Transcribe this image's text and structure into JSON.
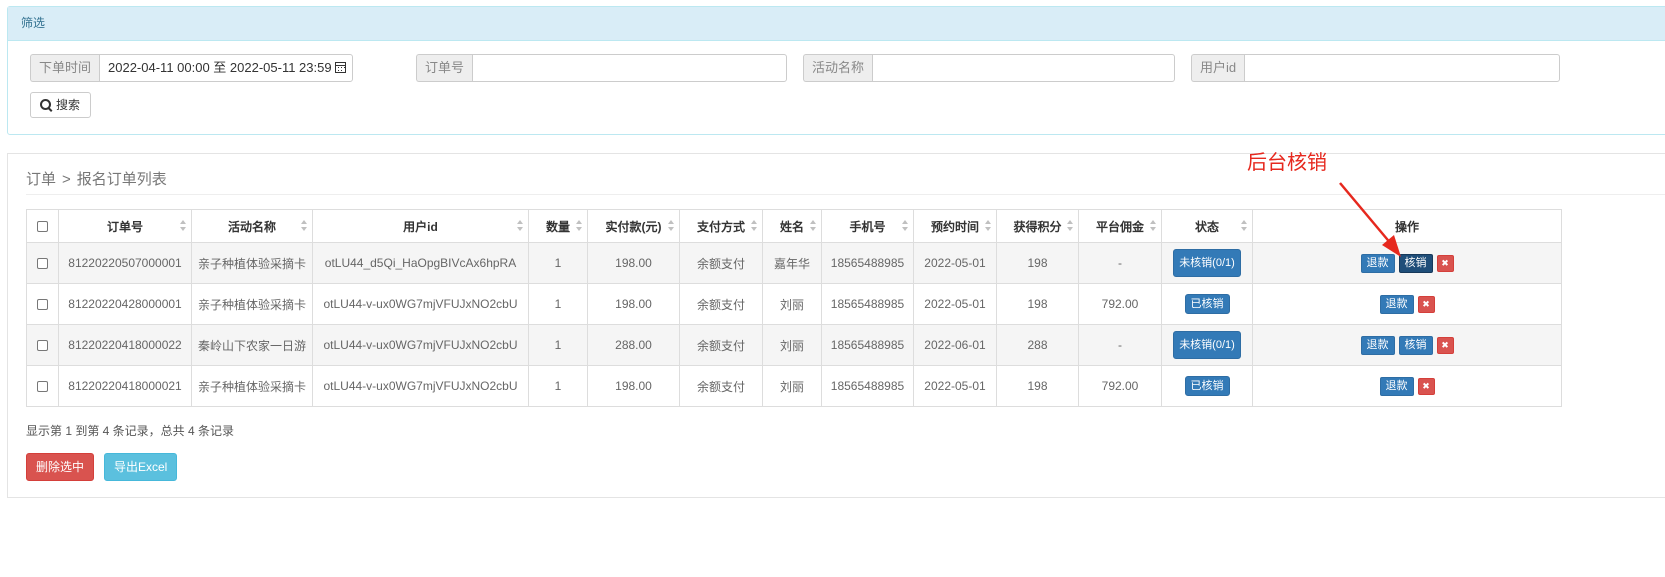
{
  "filter": {
    "heading": "筛选",
    "order_time_label": "下单时间",
    "order_time_value": "2022-04-11 00:00 至 2022-05-11 23:59",
    "order_no_label": "订单号",
    "order_no_value": "",
    "activity_label": "活动名称",
    "activity_value": "",
    "user_id_label": "用户id",
    "user_id_value": "",
    "search_label": "搜索"
  },
  "breadcrumb": {
    "root": "订单",
    "separator": ">",
    "current": "报名订单列表"
  },
  "table": {
    "columns": [
      "订单号",
      "活动名称",
      "用户id",
      "数量",
      "实付款(元)",
      "支付方式",
      "姓名",
      "手机号",
      "预约时间",
      "获得积分",
      "平台佣金",
      "状态",
      "操作"
    ],
    "rows": [
      {
        "order_no": "81220220507000001",
        "activity": "亲子种植体验采摘卡",
        "user_id": "otLU44_d5Qi_HaOpgBIVcAx6hpRA",
        "qty": "1",
        "paid": "198.00",
        "pay_method": "余额支付",
        "name": "嘉年华",
        "phone": "18565488985",
        "appt": "2022-05-01",
        "points": "198",
        "commission": "-",
        "status": "未核销(0/1)",
        "status_type": "pending",
        "refund": "退款",
        "verify": "核销"
      },
      {
        "order_no": "81220220428000001",
        "activity": "亲子种植体验采摘卡",
        "user_id": "otLU44-v-ux0WG7mjVFUJxNO2cbU",
        "qty": "1",
        "paid": "198.00",
        "pay_method": "余额支付",
        "name": "刘丽",
        "phone": "18565488985",
        "appt": "2022-05-01",
        "points": "198",
        "commission": "792.00",
        "status": "已核销",
        "status_type": "done",
        "refund": "退款"
      },
      {
        "order_no": "81220220418000022",
        "activity": "秦岭山下农家一日游",
        "user_id": "otLU44-v-ux0WG7mjVFUJxNO2cbU",
        "qty": "1",
        "paid": "288.00",
        "pay_method": "余额支付",
        "name": "刘丽",
        "phone": "18565488985",
        "appt": "2022-06-01",
        "points": "288",
        "commission": "-",
        "status": "未核销(0/1)",
        "status_type": "pending",
        "refund": "退款",
        "verify": "核销"
      },
      {
        "order_no": "81220220418000021",
        "activity": "亲子种植体验采摘卡",
        "user_id": "otLU44-v-ux0WG7mjVFUJxNO2cbU",
        "qty": "1",
        "paid": "198.00",
        "pay_method": "余额支付",
        "name": "刘丽",
        "phone": "18565488985",
        "appt": "2022-05-01",
        "points": "198",
        "commission": "792.00",
        "status": "已核销",
        "status_type": "done",
        "refund": "退款"
      }
    ]
  },
  "summary": "显示第 1 到第 4 条记录，总共 4 条记录",
  "buttons": {
    "delete_selected": "删除选中",
    "export_excel": "导出Excel"
  },
  "annotation": {
    "text": "后台核销",
    "color": "#e6281e"
  },
  "colors": {
    "primary": "#337ab7",
    "danger": "#d9534f",
    "info": "#5bc0de",
    "panel_heading": "#d9edf7"
  }
}
